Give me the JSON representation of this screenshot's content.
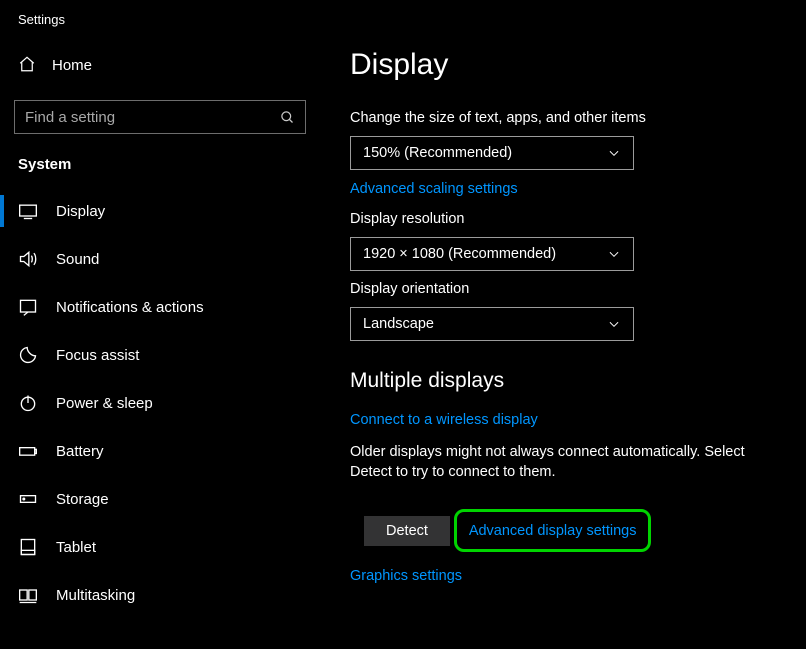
{
  "app_title": "Settings",
  "home_label": "Home",
  "search_placeholder": "Find a setting",
  "category_label": "System",
  "nav": [
    {
      "label": "Display"
    },
    {
      "label": "Sound"
    },
    {
      "label": "Notifications & actions"
    },
    {
      "label": "Focus assist"
    },
    {
      "label": "Power & sleep"
    },
    {
      "label": "Battery"
    },
    {
      "label": "Storage"
    },
    {
      "label": "Tablet"
    },
    {
      "label": "Multitasking"
    }
  ],
  "page_heading": "Display",
  "scale": {
    "label": "Change the size of text, apps, and other items",
    "value": "150% (Recommended)"
  },
  "adv_scaling_link": "Advanced scaling settings",
  "resolution": {
    "label": "Display resolution",
    "value": "1920 × 1080 (Recommended)"
  },
  "orientation": {
    "label": "Display orientation",
    "value": "Landscape"
  },
  "multi_heading": "Multiple displays",
  "connect_link": "Connect to a wireless display",
  "detect_text": "Older displays might not always connect automatically. Select Detect to try to connect to them.",
  "detect_button": "Detect",
  "adv_display_link": "Advanced display settings",
  "graphics_link": "Graphics settings"
}
